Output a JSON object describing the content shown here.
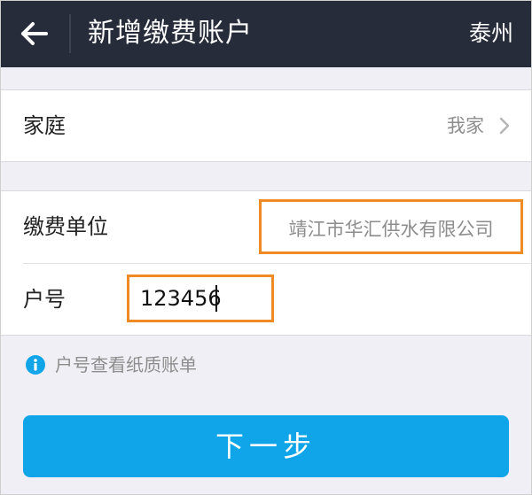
{
  "header": {
    "title": "新增缴费账户",
    "city": "泰州"
  },
  "family": {
    "label": "家庭",
    "value": "我家"
  },
  "pay_unit": {
    "label": "缴费单位",
    "value": "靖江市华汇供水有限公司"
  },
  "account": {
    "label": "户号",
    "value": "123456"
  },
  "tip": {
    "text": "户号查看纸质账单"
  },
  "next_button": {
    "label": "下一步"
  },
  "colors": {
    "header_bg": "#262c39",
    "accent_blue": "#10a4e8",
    "highlight_orange": "#f08a24",
    "page_bg": "#f0eff5"
  },
  "icons": [
    "back-arrow-icon",
    "chevron-right-icon",
    "info-icon"
  ]
}
